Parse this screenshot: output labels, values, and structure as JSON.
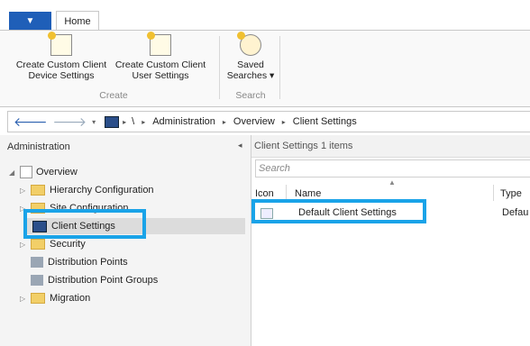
{
  "ribbon": {
    "tab_home": "Home",
    "buttons": [
      {
        "line1": "Create Custom Client",
        "line2": "Device Settings"
      },
      {
        "line1": "Create Custom Client",
        "line2": "User Settings"
      },
      {
        "line1": "Saved",
        "line2": "Searches ▾"
      }
    ],
    "groups": [
      "Create",
      "Search"
    ]
  },
  "address_bar": {
    "separator": "\\",
    "path": [
      "Administration",
      "Overview",
      "Client Settings"
    ]
  },
  "left_pane": {
    "title": "Administration",
    "tree": [
      {
        "label": "Overview"
      },
      {
        "label": "Hierarchy Configuration"
      },
      {
        "label": "Site Configuration"
      },
      {
        "label": "Client Settings"
      },
      {
        "label": "Security"
      },
      {
        "label": "Distribution Points"
      },
      {
        "label": "Distribution Point Groups"
      },
      {
        "label": "Migration"
      }
    ]
  },
  "right_pane": {
    "header": "Client Settings 1 items",
    "search_placeholder": "Search",
    "columns": [
      "Icon",
      "Name",
      "Type"
    ],
    "rows": [
      {
        "name": "Default Client Settings",
        "type": "Defau"
      }
    ]
  },
  "colors": {
    "highlight": "#1aa3e8",
    "app_button": "#1f5fb8"
  }
}
